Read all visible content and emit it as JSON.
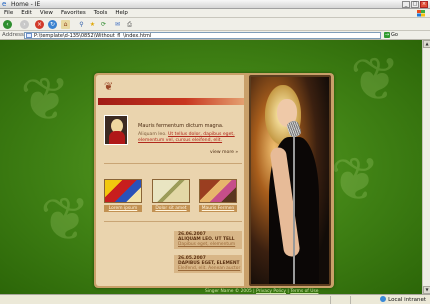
{
  "window": {
    "title": "Home - IE"
  },
  "menu": [
    "File",
    "Edit",
    "View",
    "Favorites",
    "Tools",
    "Help"
  ],
  "address": {
    "label": "Address",
    "value": "P:\\template\\d-135\\0852\\Without_fl_\\index.html",
    "go_label": "Go",
    "links_label": ""
  },
  "status": {
    "zone": "Local intranet"
  },
  "page": {
    "intro_title": "Mauris fermentum dictum magna.",
    "intro_lead": "Aliquam leo.",
    "intro_link": "Ut tellus dolor, dapibus eget, elementum vel, cursus eleifend, elit.",
    "view_more": "view more »",
    "thumbnails": [
      "Lorem ipsum",
      "Dolor sit amet",
      "Mauris Fermen"
    ],
    "news": [
      {
        "date": "26.06.2007",
        "head": "ALIQUAM LEO. UT TELL",
        "body": "Dapibus eget, elementum"
      },
      {
        "date": "26.05.2007",
        "head": "DAPIBUS EGET, ELEMENT",
        "body": "Eleifend, elit. Aenean auctor"
      }
    ],
    "footer": {
      "text": "Singer Name © 2005 |",
      "privacy": "Privacy Policy",
      "terms": "Terms of Use"
    }
  },
  "colors": {
    "accent_red": "#b0281c",
    "page_bg_green": "#3f8014",
    "card_tan": "#ead4ae"
  }
}
